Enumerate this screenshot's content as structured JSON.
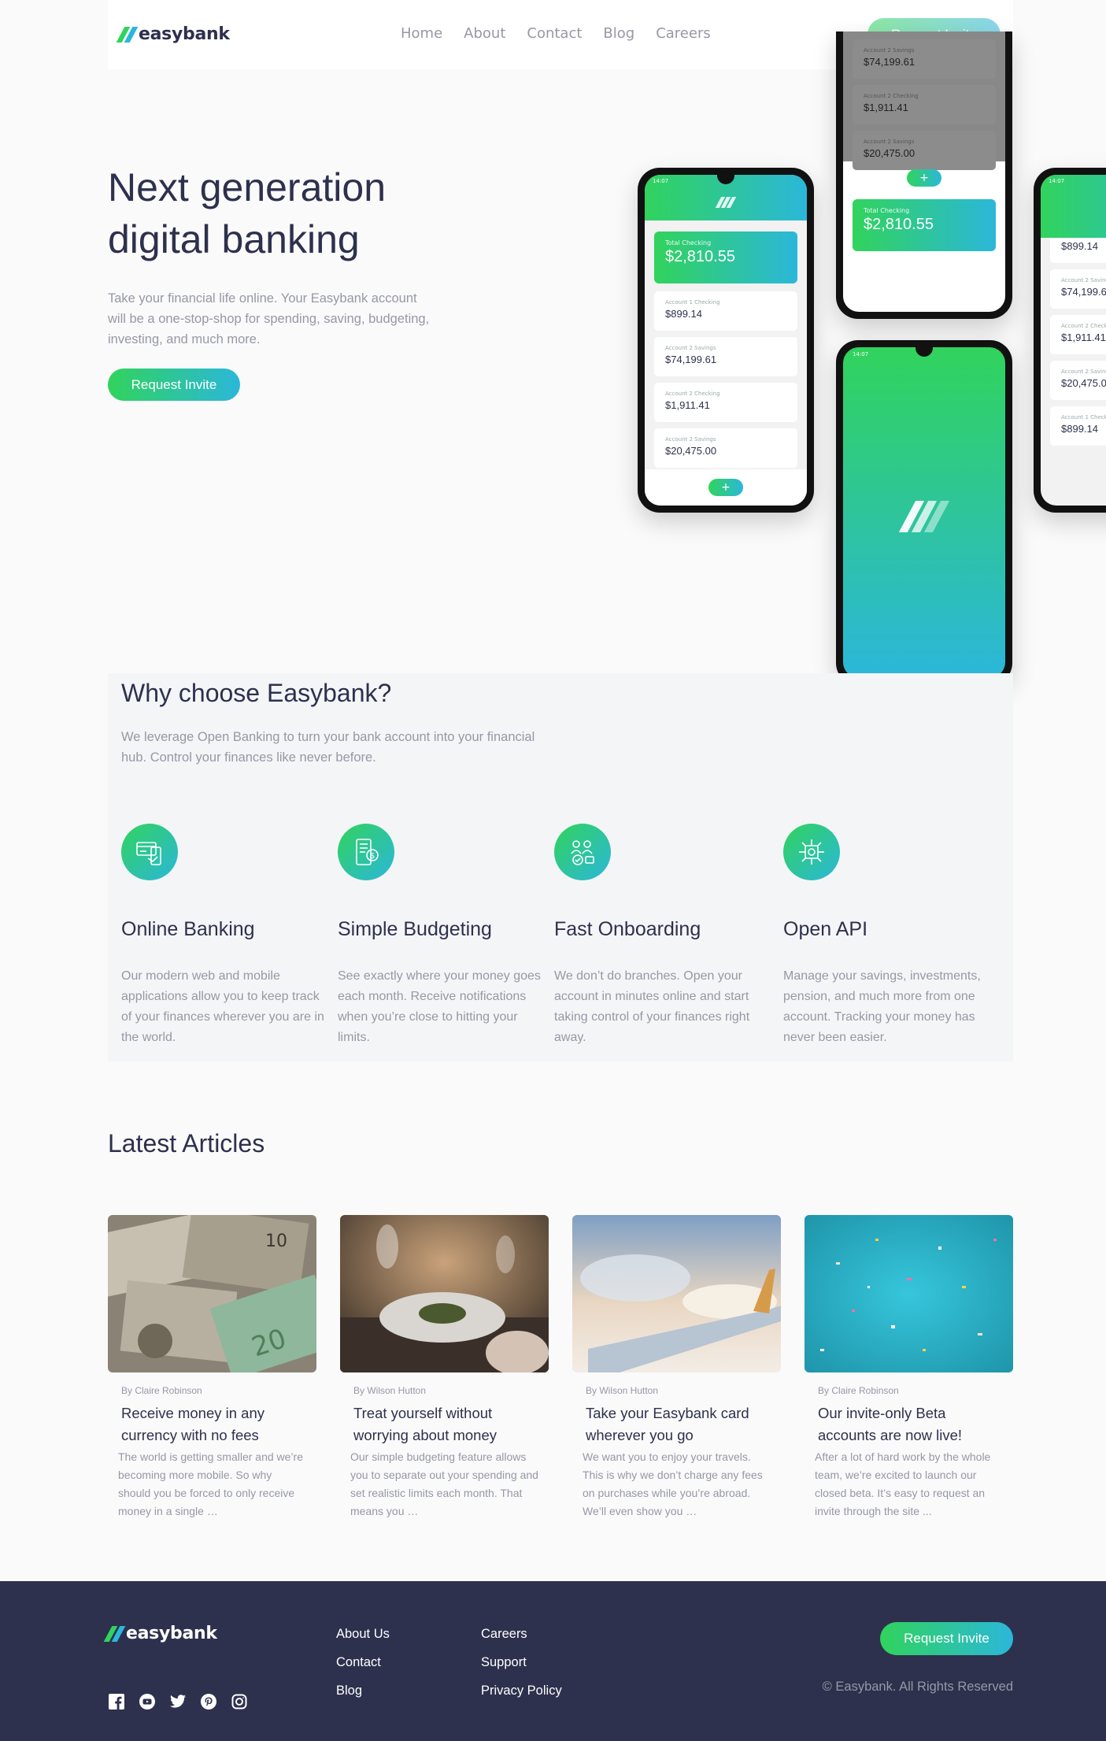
{
  "brand": {
    "name": "easybank",
    "accent_green": "#31d35c",
    "accent_cyan": "#2bb7da",
    "dark_blue": "#2d314d",
    "grayish_blue": "#9698a6"
  },
  "nav": {
    "items": [
      "Home",
      "About",
      "Contact",
      "Blog",
      "Careers"
    ],
    "cta": "Request Invite"
  },
  "hero": {
    "title_line1": "Next generation",
    "title_line2": "digital banking",
    "text": "Take your financial life online. Your Easybank account will be a one-stop-shop for spending, saving, budgeting, investing, and much more.",
    "cta": "Request Invite"
  },
  "phones": {
    "total_label": "Total Checking",
    "total_amount": "$2,810.55",
    "accounts": [
      {
        "label": "Account 1 Checking",
        "amount": "$899.14"
      },
      {
        "label": "Account 2 Savings",
        "amount": "$74,199.61"
      },
      {
        "label": "Account 2 Checking",
        "amount": "$1,911.41"
      },
      {
        "label": "Account 2 Savings",
        "amount": "$20,475.00"
      }
    ],
    "time": "14:07"
  },
  "why": {
    "title": "Why choose Easybank?",
    "text": "We leverage Open Banking to turn your bank account into your financial hub. Control your finances like never before.",
    "features": [
      {
        "icon": "online-banking-icon",
        "title": "Online Banking",
        "text": "Our modern web and mobile applications allow you to keep track of your finances wherever you are in the world."
      },
      {
        "icon": "budgeting-icon",
        "title": "Simple Budgeting",
        "text": "See exactly where your money goes each month. Receive notifications when you’re close to hitting your limits."
      },
      {
        "icon": "onboarding-icon",
        "title": "Fast Onboarding",
        "text": "We don’t do branches. Open your account in minutes online and start taking control of your finances right away."
      },
      {
        "icon": "api-icon",
        "title": "Open API",
        "text": "Manage your savings, investments, pension, and much more from one account. Tracking your money has never been easier."
      }
    ]
  },
  "articles": {
    "title": "Latest Articles",
    "items": [
      {
        "by": "By Claire Robinson",
        "title": "Receive money in any currency with no fees",
        "text": "The world is getting smaller and we’re becoming more mobile. So why should you be forced to only receive money in a single …"
      },
      {
        "by": "By Wilson Hutton",
        "title": "Treat yourself without worrying about money",
        "text": "Our simple budgeting feature allows you to separate out your spending and set realistic limits each month. That means you …"
      },
      {
        "by": "By Wilson Hutton",
        "title": "Take your Easybank card wherever you go",
        "text": "We want you to enjoy your travels. This is why we don’t charge any fees on purchases while you’re abroad. We’ll even show you …"
      },
      {
        "by": "By Claire Robinson",
        "title": "Our invite-only Beta accounts are now live!",
        "text": "After a lot of hard work by the whole team, we’re excited to launch our closed beta. It’s easy to request an invite through the site ..."
      }
    ]
  },
  "footer": {
    "col1": [
      "About Us",
      "Contact",
      "Blog"
    ],
    "col2": [
      "Careers",
      "Support",
      "Privacy Policy"
    ],
    "cta": "Request Invite",
    "copyright": "© Easybank. All Rights Reserved",
    "socials": [
      "facebook-icon",
      "youtube-icon",
      "twitter-icon",
      "pinterest-icon",
      "instagram-icon"
    ]
  }
}
